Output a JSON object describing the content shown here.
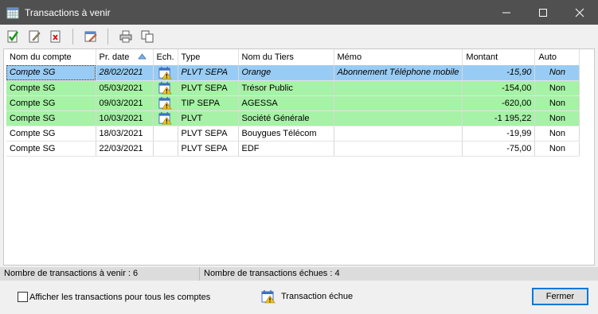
{
  "window": {
    "title": "Transactions à venir",
    "icon": "calendar-grid-icon",
    "controls": [
      "minimize-icon",
      "maximize-icon",
      "close-icon"
    ]
  },
  "toolbar": {
    "buttons": [
      {
        "name": "validate-transaction-button",
        "icon": "checked-document-icon"
      },
      {
        "name": "edit-transaction-button",
        "icon": "pencil-document-icon"
      },
      {
        "name": "delete-transaction-button",
        "icon": "x-document-icon"
      },
      {
        "name": "schedule-edit-button",
        "icon": "calendar-edit-icon"
      },
      {
        "name": "print-button",
        "icon": "printer-icon"
      },
      {
        "name": "copy-button",
        "icon": "copy-icon"
      }
    ]
  },
  "table": {
    "headers": {
      "account": "Nom du compte",
      "date": "Pr. date",
      "due": "Ech.",
      "type": "Type",
      "payee": "Nom du Tiers",
      "memo": "Mémo",
      "amount": "Montant",
      "auto": "Auto"
    },
    "sort_column": "date",
    "rows": [
      {
        "account": "Compte SG",
        "date": "28/02/2021",
        "due": true,
        "type": "PLVT SEPA",
        "payee": "Orange",
        "memo": "Abonnement Téléphone mobile",
        "amount": "-15,90",
        "auto": "Non",
        "state": "selected"
      },
      {
        "account": "Compte SG",
        "date": "05/03/2021",
        "due": true,
        "type": "PLVT SEPA",
        "payee": "Trésor Public",
        "memo": "",
        "amount": "-154,00",
        "auto": "Non",
        "state": "due"
      },
      {
        "account": "Compte SG",
        "date": "09/03/2021",
        "due": true,
        "type": "TIP SEPA",
        "payee": "AGESSA",
        "memo": "",
        "amount": "-620,00",
        "auto": "Non",
        "state": "due"
      },
      {
        "account": "Compte SG",
        "date": "10/03/2021",
        "due": true,
        "type": "PLVT",
        "payee": "Société Générale",
        "memo": "",
        "amount": "-1 195,22",
        "auto": "Non",
        "state": "due"
      },
      {
        "account": "Compte SG",
        "date": "18/03/2021",
        "due": false,
        "type": "PLVT SEPA",
        "payee": "Bouygues Télécom",
        "memo": "",
        "amount": "-19,99",
        "auto": "Non",
        "state": "normal"
      },
      {
        "account": "Compte SG",
        "date": "22/03/2021",
        "due": false,
        "type": "PLVT SEPA",
        "payee": "EDF",
        "memo": "",
        "amount": "-75,00",
        "auto": "Non",
        "state": "normal"
      }
    ]
  },
  "status": {
    "upcoming": "Nombre de transactions à venir : 6",
    "due": "Nombre de transactions échues : 4"
  },
  "footer": {
    "show_all_label": "Afficher les transactions pour tous les comptes",
    "show_all_checked": false,
    "legend_label": "Transaction échue",
    "close_label": "Fermer"
  },
  "colors": {
    "titlebar": "#505050",
    "selected_row": "#99ccf4",
    "due_row": "#a6f2a6",
    "accent": "#0078d7"
  }
}
